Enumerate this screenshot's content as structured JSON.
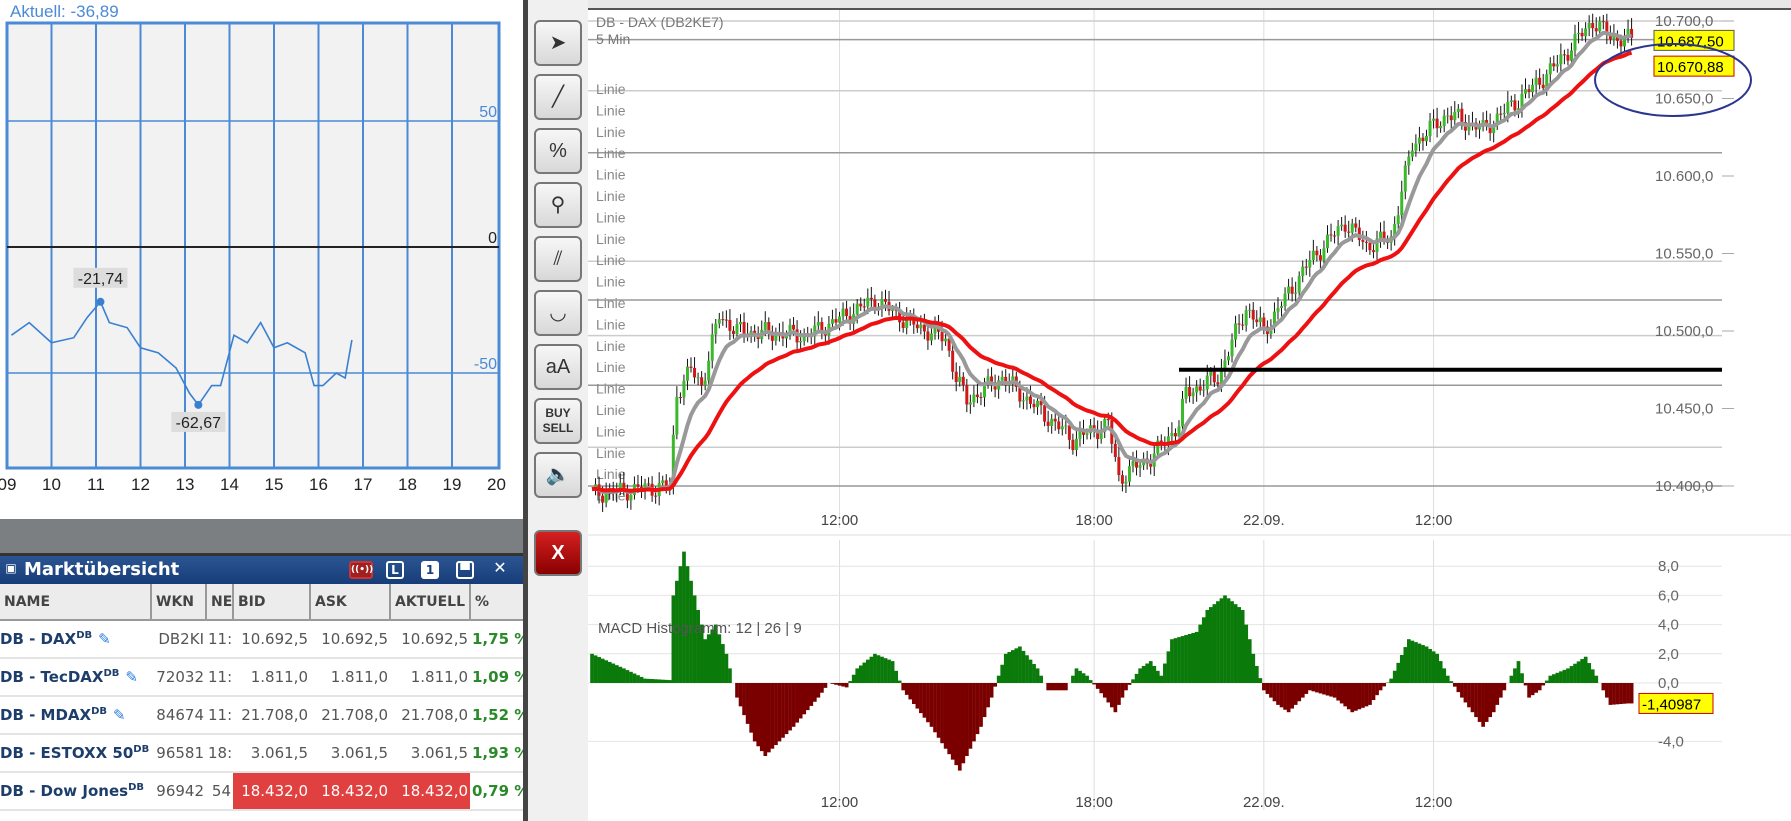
{
  "mini_chart": {
    "title": "Aktuell: -36,89",
    "y_ticks": [
      "50",
      "0",
      "-50"
    ],
    "x_ticks": [
      "09",
      "10",
      "11",
      "12",
      "13",
      "14",
      "15",
      "16",
      "17",
      "18",
      "19",
      "20"
    ],
    "annotations": [
      {
        "label": "-21,74",
        "x": 11.1,
        "y": -21.74
      },
      {
        "label": "-62,67",
        "x": 13.3,
        "y": -62.67
      }
    ],
    "series": [
      [
        9.1,
        -35
      ],
      [
        9.5,
        -30
      ],
      [
        10,
        -38
      ],
      [
        10.5,
        -36
      ],
      [
        10.8,
        -28
      ],
      [
        11.1,
        -21.74
      ],
      [
        11.3,
        -30
      ],
      [
        11.7,
        -32
      ],
      [
        12,
        -40
      ],
      [
        12.4,
        -42
      ],
      [
        12.8,
        -48
      ],
      [
        13.1,
        -58
      ],
      [
        13.3,
        -62.67
      ],
      [
        13.6,
        -55
      ],
      [
        13.8,
        -55
      ],
      [
        14.1,
        -35
      ],
      [
        14.4,
        -38
      ],
      [
        14.7,
        -30
      ],
      [
        15,
        -40
      ],
      [
        15.3,
        -38
      ],
      [
        15.7,
        -42
      ],
      [
        15.9,
        -55
      ],
      [
        16.1,
        -55
      ],
      [
        16.4,
        -50
      ],
      [
        16.6,
        -52
      ],
      [
        16.75,
        -36.89
      ]
    ]
  },
  "market_overview": {
    "title": "Marktübersicht",
    "icons": {
      "live": "((•))",
      "l": "L",
      "one": "1"
    },
    "columns": [
      "NAME",
      "WKN",
      "NE",
      "BID",
      "ASK",
      "AKTUELL",
      "%"
    ],
    "rows": [
      {
        "name": "DB - DAX",
        "sup": "DB",
        "wkn": "DB2KI",
        "ne": "11:",
        "bid": "10.692,5",
        "ask": "10.692,5",
        "akt": "10.692,5",
        "pct": "1,75 %",
        "red": false
      },
      {
        "name": "DB - TecDAX",
        "sup": "DB",
        "wkn": "72032",
        "ne": "11:",
        "bid": "1.811,0",
        "ask": "1.811,0",
        "akt": "1.811,0",
        "pct": "1,09 %",
        "red": false
      },
      {
        "name": "DB - MDAX",
        "sup": "DB",
        "wkn": "84674",
        "ne": "11:",
        "bid": "21.708,0",
        "ask": "21.708,0",
        "akt": "21.708,0",
        "pct": "1,52 %",
        "red": false
      },
      {
        "name": "DB - ESTOXX 50",
        "sup": "DB",
        "wkn": "96581",
        "ne": "18:",
        "bid": "3.061,5",
        "ask": "3.061,5",
        "akt": "3.061,5",
        "pct": "1,93 %",
        "red": false
      },
      {
        "name": "DB - Dow Jones",
        "sup": "DB",
        "wkn": "96942",
        "ne": "54",
        "bid": "18.432,0",
        "ask": "18.432,0",
        "akt": "18.432,0",
        "pct": "0,79 %",
        "red": true
      }
    ]
  },
  "toolbar": [
    {
      "name": "cursor-crosshair",
      "g": "➤"
    },
    {
      "name": "line-tool",
      "g": "╱"
    },
    {
      "name": "percent-tool",
      "g": "%"
    },
    {
      "name": "zoom-tool",
      "g": "⚲"
    },
    {
      "name": "parallel-lines-tool",
      "g": "⫽"
    },
    {
      "name": "curve-tool",
      "g": "◡"
    },
    {
      "name": "font-size-tool",
      "g": "aA"
    },
    {
      "name": "buy-sell-tool",
      "g": "BUY SELL"
    },
    {
      "name": "sound-tool",
      "g": "🔈"
    },
    {
      "name": "close-tool",
      "g": "X"
    }
  ],
  "main_chart": {
    "title": "DB - DAX (DB2KE7)",
    "interval": "5 Min",
    "line_label": "Linie",
    "line_count": 20,
    "y_ticks": [
      "10.700,0",
      "10.650,0",
      "10.600,0",
      "10.550,0",
      "10.500,0",
      "10.450,0",
      "10.400,0"
    ],
    "y_values": [
      10700,
      10650,
      10600,
      10550,
      10500,
      10450,
      10400
    ],
    "x_ticks": [
      {
        "label": "12:00",
        "bar": 70
      },
      {
        "label": "18:00",
        "bar": 142
      },
      {
        "label": "22.09.",
        "bar": 190
      },
      {
        "label": "12:00",
        "bar": 238
      }
    ],
    "price_label_1": "10.687,50",
    "price_label_2": "10.670,88",
    "hline": 10475,
    "price_keypoints": [
      [
        0,
        10395
      ],
      [
        22,
        10400
      ],
      [
        24,
        10460
      ],
      [
        28,
        10475
      ],
      [
        31,
        10465
      ],
      [
        36,
        10510
      ],
      [
        41,
        10500
      ],
      [
        61,
        10497
      ],
      [
        80,
        10520
      ],
      [
        90,
        10505
      ],
      [
        100,
        10495
      ],
      [
        103,
        10470
      ],
      [
        106,
        10455
      ],
      [
        116,
        10470
      ],
      [
        126,
        10450
      ],
      [
        136,
        10430
      ],
      [
        146,
        10440
      ],
      [
        149,
        10405
      ],
      [
        159,
        10420
      ],
      [
        166,
        10440
      ],
      [
        168,
        10460
      ],
      [
        177,
        10470
      ],
      [
        185,
        10515
      ],
      [
        190,
        10500
      ],
      [
        203,
        10545
      ],
      [
        213,
        10570
      ],
      [
        219,
        10555
      ],
      [
        226,
        10560
      ],
      [
        232,
        10620
      ],
      [
        242,
        10640
      ],
      [
        252,
        10630
      ],
      [
        265,
        10655
      ],
      [
        272,
        10670
      ],
      [
        283,
        10700
      ],
      [
        288,
        10690
      ],
      [
        293,
        10688
      ]
    ]
  },
  "macd": {
    "title": "MACD Histogramm: 12 | 26 | 9",
    "y_ticks": [
      "8,0",
      "6,0",
      "4,0",
      "2,0",
      "0,0",
      "-4,0"
    ],
    "y_values": [
      8,
      6,
      4,
      2,
      0,
      -4
    ],
    "current": "-1,40987",
    "keypoints": [
      [
        0,
        2
      ],
      [
        9,
        1
      ],
      [
        15,
        0.3
      ],
      [
        22,
        0.2
      ],
      [
        23,
        6
      ],
      [
        26,
        9
      ],
      [
        28,
        7
      ],
      [
        32,
        3
      ],
      [
        35,
        4
      ],
      [
        38,
        2
      ],
      [
        41,
        -1
      ],
      [
        46,
        -4
      ],
      [
        49,
        -5
      ],
      [
        57,
        -3
      ],
      [
        64,
        -1
      ],
      [
        67,
        0
      ],
      [
        72,
        -0.3
      ],
      [
        75,
        1
      ],
      [
        80,
        2
      ],
      [
        85,
        1.5
      ],
      [
        88,
        -0.5
      ],
      [
        96,
        -3
      ],
      [
        104,
        -6
      ],
      [
        110,
        -3
      ],
      [
        113,
        -1
      ],
      [
        117,
        2
      ],
      [
        121,
        2.5
      ],
      [
        126,
        1
      ],
      [
        129,
        -0.5
      ],
      [
        134,
        -0.5
      ],
      [
        137,
        1
      ],
      [
        140,
        0.5
      ],
      [
        145,
        -1
      ],
      [
        148,
        -2
      ],
      [
        151,
        -0.5
      ],
      [
        155,
        1
      ],
      [
        158,
        1.5
      ],
      [
        161,
        0.5
      ],
      [
        164,
        3
      ],
      [
        171,
        3.5
      ],
      [
        174,
        5
      ],
      [
        179,
        6
      ],
      [
        184,
        5
      ],
      [
        187,
        2
      ],
      [
        190,
        -0.5
      ],
      [
        194,
        -1.5
      ],
      [
        197,
        -2
      ],
      [
        203,
        -0.5
      ],
      [
        210,
        -1
      ],
      [
        215,
        -2
      ],
      [
        220,
        -1.5
      ],
      [
        223,
        -0.5
      ],
      [
        226,
        0.3
      ],
      [
        231,
        3
      ],
      [
        236,
        2.5
      ],
      [
        239,
        2
      ],
      [
        242,
        0.5
      ],
      [
        246,
        -1
      ],
      [
        252,
        -3
      ],
      [
        255,
        -2
      ],
      [
        258,
        -0.5
      ],
      [
        262,
        1.5
      ],
      [
        265,
        -1
      ],
      [
        268,
        -0.5
      ],
      [
        271,
        0.5
      ],
      [
        276,
        1
      ],
      [
        281,
        1.8
      ],
      [
        284,
        0.5
      ],
      [
        288,
        -1.5
      ],
      [
        293,
        -1.4
      ]
    ]
  },
  "colors": {
    "up": "#3cb82c",
    "down": "#d01818",
    "ma_fast": "#999999",
    "ma_slow": "#ee1111",
    "macd_pos": "#0a7a0a",
    "macd_neg": "#7a0000",
    "label_bg": "#ffff00",
    "grid_blue": "#4a8ad6"
  }
}
